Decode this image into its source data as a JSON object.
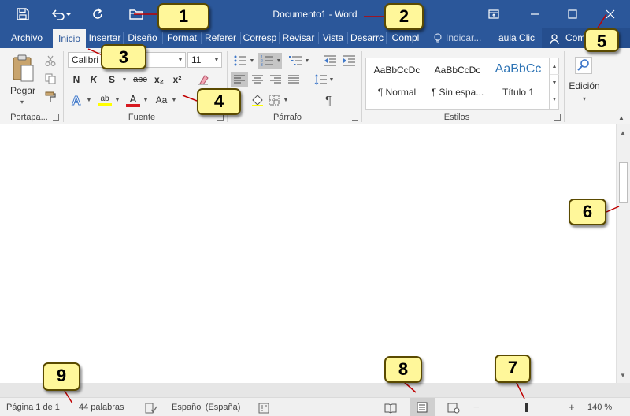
{
  "window": {
    "title": "Documento1 - Word",
    "accent": "#2b579a"
  },
  "tabs": [
    "Archivo",
    "Inicio",
    "Insertar",
    "Diseño",
    "Format",
    "Referer",
    "Corresp",
    "Revisar",
    "Vista",
    "Desarrc",
    "Compl"
  ],
  "tell_me": "Indicar...",
  "aula": "aula Clic",
  "share_label": "Com",
  "ribbon": {
    "clipboard": {
      "paste_label": "Pegar",
      "group_label": "Portapa..."
    },
    "font": {
      "font_name": "Calibri (",
      "font_size": "11",
      "bold": "N",
      "italic": "K",
      "underline": "S",
      "strike": "abc",
      "subscript": "x₂",
      "superscript": "x²",
      "change_case": "Aa",
      "highlight_text": "ab",
      "font_color_text": "A",
      "group_label": "Fuente"
    },
    "paragraph": {
      "group_label": "Párrafo",
      "pilcrow": "¶"
    },
    "styles": {
      "group_label": "Estilos",
      "items": [
        {
          "sample": "AaBbCcDc",
          "name": "¶ Normal"
        },
        {
          "sample": "AaBbCcDc",
          "name": "¶ Sin espa..."
        },
        {
          "sample": "AaBbCc",
          "name": "Título 1"
        }
      ]
    },
    "editing": {
      "label": "Edición"
    }
  },
  "status": {
    "page": "Página 1 de 1",
    "words": "44 palabras",
    "language": "Español (España)",
    "zoom_minus": "−",
    "zoom_plus": "+",
    "zoom": "140 %",
    "zoom_value": 140
  },
  "callouts": [
    "1",
    "2",
    "3",
    "4",
    "5",
    "6",
    "7",
    "8",
    "9"
  ]
}
